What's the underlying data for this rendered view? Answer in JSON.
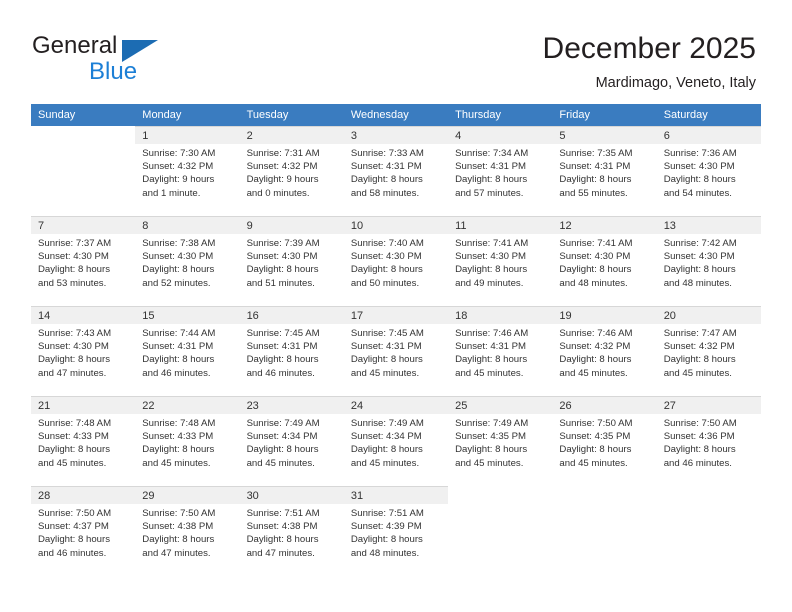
{
  "brand": {
    "name_part1": "General",
    "name_part2": "Blue",
    "triangle_icon": "triangle-icon",
    "color_dark": "#231f20",
    "color_blue": "#1c7fd6",
    "color_triangle": "#1c6cb3"
  },
  "header": {
    "title": "December 2025",
    "subtitle": "Mardimago, Veneto, Italy",
    "header_bg": "#3a7cc0"
  },
  "weekdays": [
    {
      "label": "Sunday"
    },
    {
      "label": "Monday"
    },
    {
      "label": "Tuesday"
    },
    {
      "label": "Wednesday"
    },
    {
      "label": "Thursday"
    },
    {
      "label": "Friday"
    },
    {
      "label": "Saturday"
    }
  ],
  "weeks": [
    {
      "days": [
        {
          "day": "",
          "sunrise": "",
          "sunset": "",
          "daylight_line1": "",
          "daylight_line2": "",
          "empty": true
        },
        {
          "day": "1",
          "sunrise": "Sunrise: 7:30 AM",
          "sunset": "Sunset: 4:32 PM",
          "daylight_line1": "Daylight: 9 hours",
          "daylight_line2": "and 1 minute.",
          "empty": false
        },
        {
          "day": "2",
          "sunrise": "Sunrise: 7:31 AM",
          "sunset": "Sunset: 4:32 PM",
          "daylight_line1": "Daylight: 9 hours",
          "daylight_line2": "and 0 minutes.",
          "empty": false
        },
        {
          "day": "3",
          "sunrise": "Sunrise: 7:33 AM",
          "sunset": "Sunset: 4:31 PM",
          "daylight_line1": "Daylight: 8 hours",
          "daylight_line2": "and 58 minutes.",
          "empty": false
        },
        {
          "day": "4",
          "sunrise": "Sunrise: 7:34 AM",
          "sunset": "Sunset: 4:31 PM",
          "daylight_line1": "Daylight: 8 hours",
          "daylight_line2": "and 57 minutes.",
          "empty": false
        },
        {
          "day": "5",
          "sunrise": "Sunrise: 7:35 AM",
          "sunset": "Sunset: 4:31 PM",
          "daylight_line1": "Daylight: 8 hours",
          "daylight_line2": "and 55 minutes.",
          "empty": false
        },
        {
          "day": "6",
          "sunrise": "Sunrise: 7:36 AM",
          "sunset": "Sunset: 4:30 PM",
          "daylight_line1": "Daylight: 8 hours",
          "daylight_line2": "and 54 minutes.",
          "empty": false
        }
      ]
    },
    {
      "days": [
        {
          "day": "7",
          "sunrise": "Sunrise: 7:37 AM",
          "sunset": "Sunset: 4:30 PM",
          "daylight_line1": "Daylight: 8 hours",
          "daylight_line2": "and 53 minutes.",
          "empty": false
        },
        {
          "day": "8",
          "sunrise": "Sunrise: 7:38 AM",
          "sunset": "Sunset: 4:30 PM",
          "daylight_line1": "Daylight: 8 hours",
          "daylight_line2": "and 52 minutes.",
          "empty": false
        },
        {
          "day": "9",
          "sunrise": "Sunrise: 7:39 AM",
          "sunset": "Sunset: 4:30 PM",
          "daylight_line1": "Daylight: 8 hours",
          "daylight_line2": "and 51 minutes.",
          "empty": false
        },
        {
          "day": "10",
          "sunrise": "Sunrise: 7:40 AM",
          "sunset": "Sunset: 4:30 PM",
          "daylight_line1": "Daylight: 8 hours",
          "daylight_line2": "and 50 minutes.",
          "empty": false
        },
        {
          "day": "11",
          "sunrise": "Sunrise: 7:41 AM",
          "sunset": "Sunset: 4:30 PM",
          "daylight_line1": "Daylight: 8 hours",
          "daylight_line2": "and 49 minutes.",
          "empty": false
        },
        {
          "day": "12",
          "sunrise": "Sunrise: 7:41 AM",
          "sunset": "Sunset: 4:30 PM",
          "daylight_line1": "Daylight: 8 hours",
          "daylight_line2": "and 48 minutes.",
          "empty": false
        },
        {
          "day": "13",
          "sunrise": "Sunrise: 7:42 AM",
          "sunset": "Sunset: 4:30 PM",
          "daylight_line1": "Daylight: 8 hours",
          "daylight_line2": "and 48 minutes.",
          "empty": false
        }
      ]
    },
    {
      "days": [
        {
          "day": "14",
          "sunrise": "Sunrise: 7:43 AM",
          "sunset": "Sunset: 4:30 PM",
          "daylight_line1": "Daylight: 8 hours",
          "daylight_line2": "and 47 minutes.",
          "empty": false
        },
        {
          "day": "15",
          "sunrise": "Sunrise: 7:44 AM",
          "sunset": "Sunset: 4:31 PM",
          "daylight_line1": "Daylight: 8 hours",
          "daylight_line2": "and 46 minutes.",
          "empty": false
        },
        {
          "day": "16",
          "sunrise": "Sunrise: 7:45 AM",
          "sunset": "Sunset: 4:31 PM",
          "daylight_line1": "Daylight: 8 hours",
          "daylight_line2": "and 46 minutes.",
          "empty": false
        },
        {
          "day": "17",
          "sunrise": "Sunrise: 7:45 AM",
          "sunset": "Sunset: 4:31 PM",
          "daylight_line1": "Daylight: 8 hours",
          "daylight_line2": "and 45 minutes.",
          "empty": false
        },
        {
          "day": "18",
          "sunrise": "Sunrise: 7:46 AM",
          "sunset": "Sunset: 4:31 PM",
          "daylight_line1": "Daylight: 8 hours",
          "daylight_line2": "and 45 minutes.",
          "empty": false
        },
        {
          "day": "19",
          "sunrise": "Sunrise: 7:46 AM",
          "sunset": "Sunset: 4:32 PM",
          "daylight_line1": "Daylight: 8 hours",
          "daylight_line2": "and 45 minutes.",
          "empty": false
        },
        {
          "day": "20",
          "sunrise": "Sunrise: 7:47 AM",
          "sunset": "Sunset: 4:32 PM",
          "daylight_line1": "Daylight: 8 hours",
          "daylight_line2": "and 45 minutes.",
          "empty": false
        }
      ]
    },
    {
      "days": [
        {
          "day": "21",
          "sunrise": "Sunrise: 7:48 AM",
          "sunset": "Sunset: 4:33 PM",
          "daylight_line1": "Daylight: 8 hours",
          "daylight_line2": "and 45 minutes.",
          "empty": false
        },
        {
          "day": "22",
          "sunrise": "Sunrise: 7:48 AM",
          "sunset": "Sunset: 4:33 PM",
          "daylight_line1": "Daylight: 8 hours",
          "daylight_line2": "and 45 minutes.",
          "empty": false
        },
        {
          "day": "23",
          "sunrise": "Sunrise: 7:49 AM",
          "sunset": "Sunset: 4:34 PM",
          "daylight_line1": "Daylight: 8 hours",
          "daylight_line2": "and 45 minutes.",
          "empty": false
        },
        {
          "day": "24",
          "sunrise": "Sunrise: 7:49 AM",
          "sunset": "Sunset: 4:34 PM",
          "daylight_line1": "Daylight: 8 hours",
          "daylight_line2": "and 45 minutes.",
          "empty": false
        },
        {
          "day": "25",
          "sunrise": "Sunrise: 7:49 AM",
          "sunset": "Sunset: 4:35 PM",
          "daylight_line1": "Daylight: 8 hours",
          "daylight_line2": "and 45 minutes.",
          "empty": false
        },
        {
          "day": "26",
          "sunrise": "Sunrise: 7:50 AM",
          "sunset": "Sunset: 4:35 PM",
          "daylight_line1": "Daylight: 8 hours",
          "daylight_line2": "and 45 minutes.",
          "empty": false
        },
        {
          "day": "27",
          "sunrise": "Sunrise: 7:50 AM",
          "sunset": "Sunset: 4:36 PM",
          "daylight_line1": "Daylight: 8 hours",
          "daylight_line2": "and 46 minutes.",
          "empty": false
        }
      ]
    },
    {
      "days": [
        {
          "day": "28",
          "sunrise": "Sunrise: 7:50 AM",
          "sunset": "Sunset: 4:37 PM",
          "daylight_line1": "Daylight: 8 hours",
          "daylight_line2": "and 46 minutes.",
          "empty": false
        },
        {
          "day": "29",
          "sunrise": "Sunrise: 7:50 AM",
          "sunset": "Sunset: 4:38 PM",
          "daylight_line1": "Daylight: 8 hours",
          "daylight_line2": "and 47 minutes.",
          "empty": false
        },
        {
          "day": "30",
          "sunrise": "Sunrise: 7:51 AM",
          "sunset": "Sunset: 4:38 PM",
          "daylight_line1": "Daylight: 8 hours",
          "daylight_line2": "and 47 minutes.",
          "empty": false
        },
        {
          "day": "31",
          "sunrise": "Sunrise: 7:51 AM",
          "sunset": "Sunset: 4:39 PM",
          "daylight_line1": "Daylight: 8 hours",
          "daylight_line2": "and 48 minutes.",
          "empty": false
        },
        {
          "day": "",
          "sunrise": "",
          "sunset": "",
          "daylight_line1": "",
          "daylight_line2": "",
          "empty": true
        },
        {
          "day": "",
          "sunrise": "",
          "sunset": "",
          "daylight_line1": "",
          "daylight_line2": "",
          "empty": true
        },
        {
          "day": "",
          "sunrise": "",
          "sunset": "",
          "daylight_line1": "",
          "daylight_line2": "",
          "empty": true
        }
      ]
    }
  ]
}
